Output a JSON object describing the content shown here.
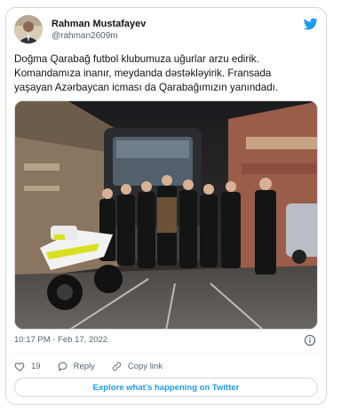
{
  "tweet": {
    "display_name": "Rahman Mustafayev",
    "handle": "@rahman2609m",
    "text_lines": [
      "Doğma Qarabağ futbol klubumuza uğurlar arzu edirik.",
      "Komandamıza inanır, meydanda dəstəkləyirik. Fransada",
      "yaşayan Azərbaycan icması da Qarabağımızın yanındadı."
    ],
    "timestamp": "10:17 PM · Feb 17, 2022",
    "likes_count": "19",
    "reply_label": "Reply",
    "copy_link_label": "Copy link",
    "explore_label": "Explore what’s happening on Twitter"
  },
  "icons": {
    "brand": "twitter-bird-icon",
    "like": "heart-icon",
    "reply": "speech-bubble-icon",
    "copy": "link-icon",
    "info": "info-icon"
  },
  "colors": {
    "accent": "#1d9bf0",
    "secondary_text": "#536471",
    "border": "#cfd9de"
  }
}
